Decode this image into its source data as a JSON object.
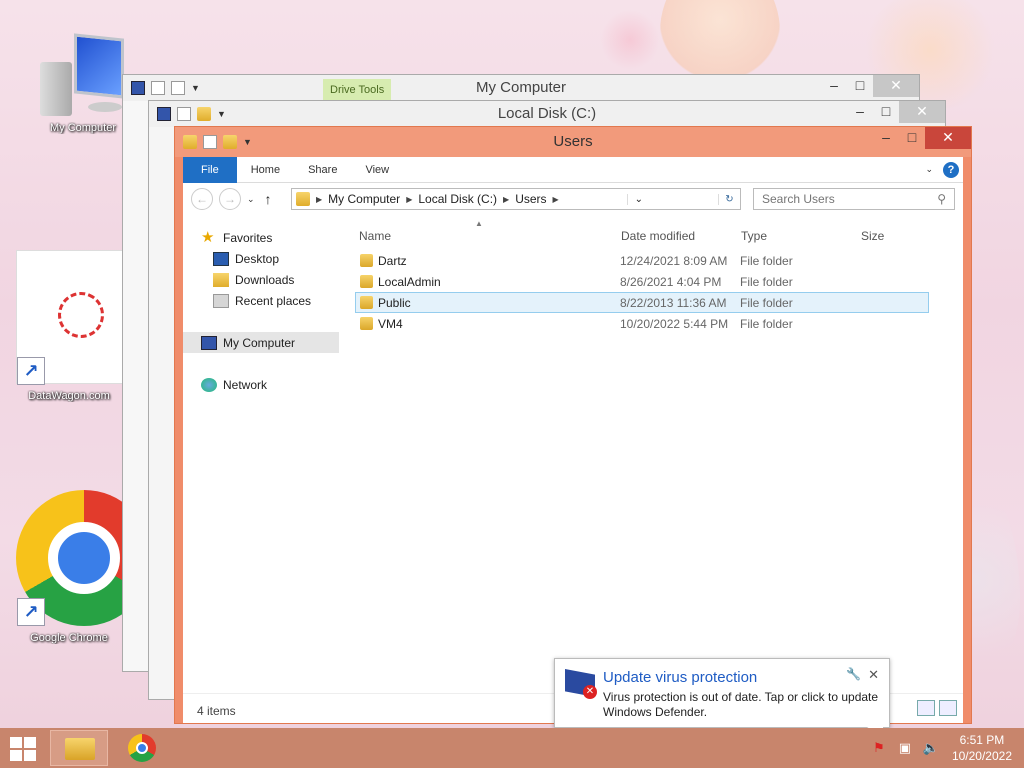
{
  "desktop": {
    "icons": [
      {
        "label": "My Computer"
      },
      {
        "label": "DataWagon.com"
      },
      {
        "label": "Google Chrome"
      }
    ]
  },
  "back_windows": {
    "my_computer": {
      "title": "My Computer",
      "context_tab": "Drive Tools"
    },
    "local_disk": {
      "title": "Local Disk (C:)"
    }
  },
  "window": {
    "title": "Users",
    "ribbon": {
      "file": "File",
      "home": "Home",
      "share": "Share",
      "view": "View",
      "help": "?"
    },
    "address": {
      "crumbs": [
        "My Computer",
        "Local Disk (C:)",
        "Users"
      ]
    },
    "search": {
      "placeholder": "Search Users"
    },
    "nav": {
      "favorites": "Favorites",
      "desktop": "Desktop",
      "downloads": "Downloads",
      "recent": "Recent places",
      "computer": "My Computer",
      "network": "Network"
    },
    "columns": {
      "name": "Name",
      "date": "Date modified",
      "type": "Type",
      "size": "Size"
    },
    "files": [
      {
        "name": "Dartz",
        "date": "12/24/2021 8:09 AM",
        "type": "File folder"
      },
      {
        "name": "LocalAdmin",
        "date": "8/26/2021 4:04 PM",
        "type": "File folder"
      },
      {
        "name": "Public",
        "date": "8/22/2013 11:36 AM",
        "type": "File folder"
      },
      {
        "name": "VM4",
        "date": "10/20/2022 5:44 PM",
        "type": "File folder"
      }
    ],
    "status": "4 items"
  },
  "notification": {
    "title": "Update virus protection",
    "body": "Virus protection is out of date. Tap or click to update Windows Defender."
  },
  "taskbar": {
    "time": "6:51 PM",
    "date": "10/20/2022"
  },
  "colors": {
    "accent": "#f08c6a",
    "file_tab": "#1f6fc5",
    "selection": "#e4f2fb"
  }
}
